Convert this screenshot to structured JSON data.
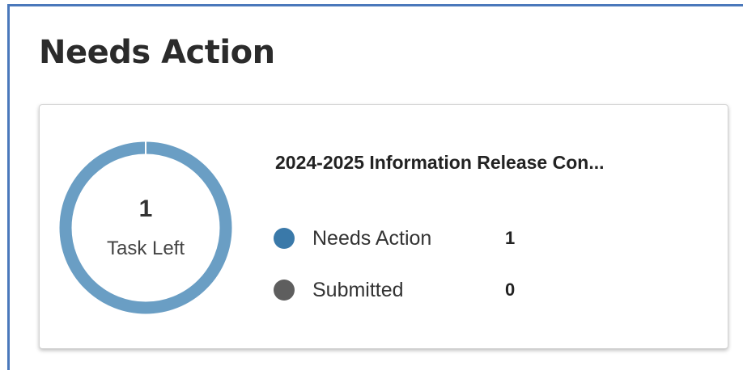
{
  "header": {
    "title": "Needs Action"
  },
  "card": {
    "progress": {
      "count": "1",
      "label": "Task Left",
      "fraction_needs_action": 1.0,
      "ring_color": "#6a9ec4"
    },
    "task_title": "2024-2025 Information Release Con...",
    "legend": [
      {
        "label": "Needs Action",
        "value": "1",
        "color": "#3a79a9"
      },
      {
        "label": "Submitted",
        "value": "0",
        "color": "#5e5e5e"
      }
    ]
  },
  "colors": {
    "frame_border": "#4a78bb"
  }
}
